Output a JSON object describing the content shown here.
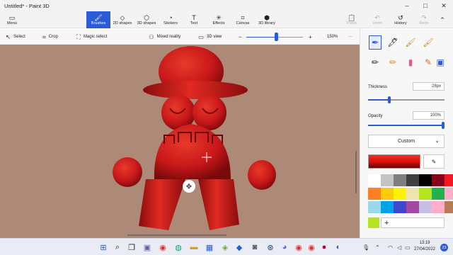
{
  "window": {
    "title": "Untitled* - Paint 3D"
  },
  "ribbon": {
    "menu": "Menu",
    "tools": [
      {
        "label": "Brushes",
        "icon": "brush-icon",
        "active": true
      },
      {
        "label": "2D shapes",
        "icon": "shapes-2d-icon"
      },
      {
        "label": "3D shapes",
        "icon": "cube-icon"
      },
      {
        "label": "Stickers",
        "icon": "sticker-icon"
      },
      {
        "label": "Text",
        "icon": "text-icon"
      },
      {
        "label": "Effects",
        "icon": "effects-icon"
      },
      {
        "label": "Canvas",
        "icon": "canvas-icon"
      },
      {
        "label": "3D library",
        "icon": "library-icon"
      }
    ],
    "right": [
      {
        "label": "Paste",
        "icon": "paste-icon",
        "disabled": true
      },
      {
        "label": "Undo",
        "icon": "undo-icon",
        "disabled": true
      },
      {
        "label": "History",
        "icon": "history-icon"
      },
      {
        "label": "Redo",
        "icon": "redo-icon",
        "disabled": true
      }
    ]
  },
  "toolbar": {
    "select": "Select",
    "crop": "Crop",
    "magic_select": "Magic select",
    "mixed_reality": "Mixed reality",
    "view_3d": "3D view",
    "zoom_out": "−",
    "zoom_in": "+",
    "zoom_level": "150%",
    "zoom_fraction": 0.55,
    "more": "···"
  },
  "panel": {
    "thickness_label": "Thickness",
    "thickness_value": "28px",
    "thickness_fraction": 0.28,
    "opacity_label": "Opacity",
    "opacity_value": "100%",
    "opacity_fraction": 1.0,
    "preset": "Custom",
    "current_color": "#e01818",
    "palette": [
      "#ffffff",
      "#c3c3c3",
      "#7f7f7f",
      "#3f3f3f",
      "#000000",
      "#880015",
      "#ed1c24",
      "#ff7f27",
      "#ffc90e",
      "#fff200",
      "#efe4b0",
      "#b5e61d",
      "#22b14c",
      "#ffaec9",
      "#99d9ea",
      "#00a2e8",
      "#3f48cc",
      "#a349a4",
      "#c8bfe7",
      "#ffaec9",
      "#b97a57",
      "#b5e61d"
    ],
    "add_color": "+"
  },
  "taskbar": {
    "time": "13:19",
    "date": "27/04/2022",
    "notifications": "23"
  },
  "colors": {
    "accent": "#2b5bd7",
    "canvas_bg": "#ad8a78",
    "figure": "#d01a18"
  }
}
